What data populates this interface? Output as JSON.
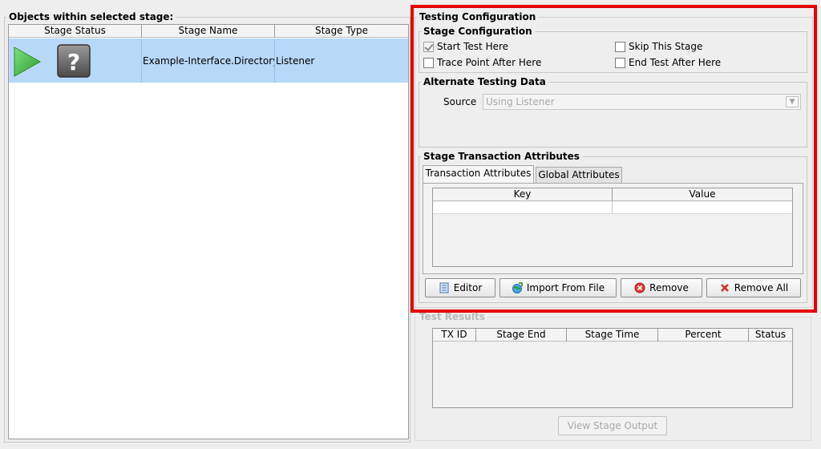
{
  "left_panel": {
    "title": "Objects within selected stage:",
    "columns": [
      "Stage Status",
      "Stage Name",
      "Stage Type"
    ],
    "rows": [
      {
        "status_icons": [
          "play-icon",
          "question-icon"
        ],
        "name": "Example-Interface.Directory ...",
        "type": "Listener"
      }
    ]
  },
  "testing_config": {
    "title": "Testing Configuration",
    "stage_config": {
      "title": "Stage Configuration",
      "start_test_here": {
        "label": "Start Test Here",
        "checked": true
      },
      "skip_this_stage": {
        "label": "Skip This Stage",
        "checked": false
      },
      "trace_point_after_here": {
        "label": "Trace Point After Here",
        "checked": false
      },
      "end_test_after_here": {
        "label": "End Test After Here",
        "checked": false
      }
    },
    "alternate_data": {
      "title": "Alternate Testing Data",
      "source_label": "Source",
      "source_value": "Using Listener"
    },
    "transaction_attrs": {
      "title": "Stage Transaction Attributes",
      "tabs": [
        "Transaction Attributes",
        "Global Attributes"
      ],
      "columns": [
        "Key",
        "Value"
      ],
      "buttons": {
        "editor": "Editor",
        "import": "Import From File",
        "remove": "Remove",
        "remove_all": "Remove All"
      }
    }
  },
  "test_results": {
    "title": "Test Results",
    "columns": [
      "TX ID",
      "Stage End",
      "Stage Time",
      "Percent",
      "Status"
    ],
    "view_output_button": "View Stage Output"
  },
  "colors": {
    "highlight_frame": "#e60000",
    "selected_row": "#b8d8f8",
    "play_green": "#3cb83c"
  }
}
